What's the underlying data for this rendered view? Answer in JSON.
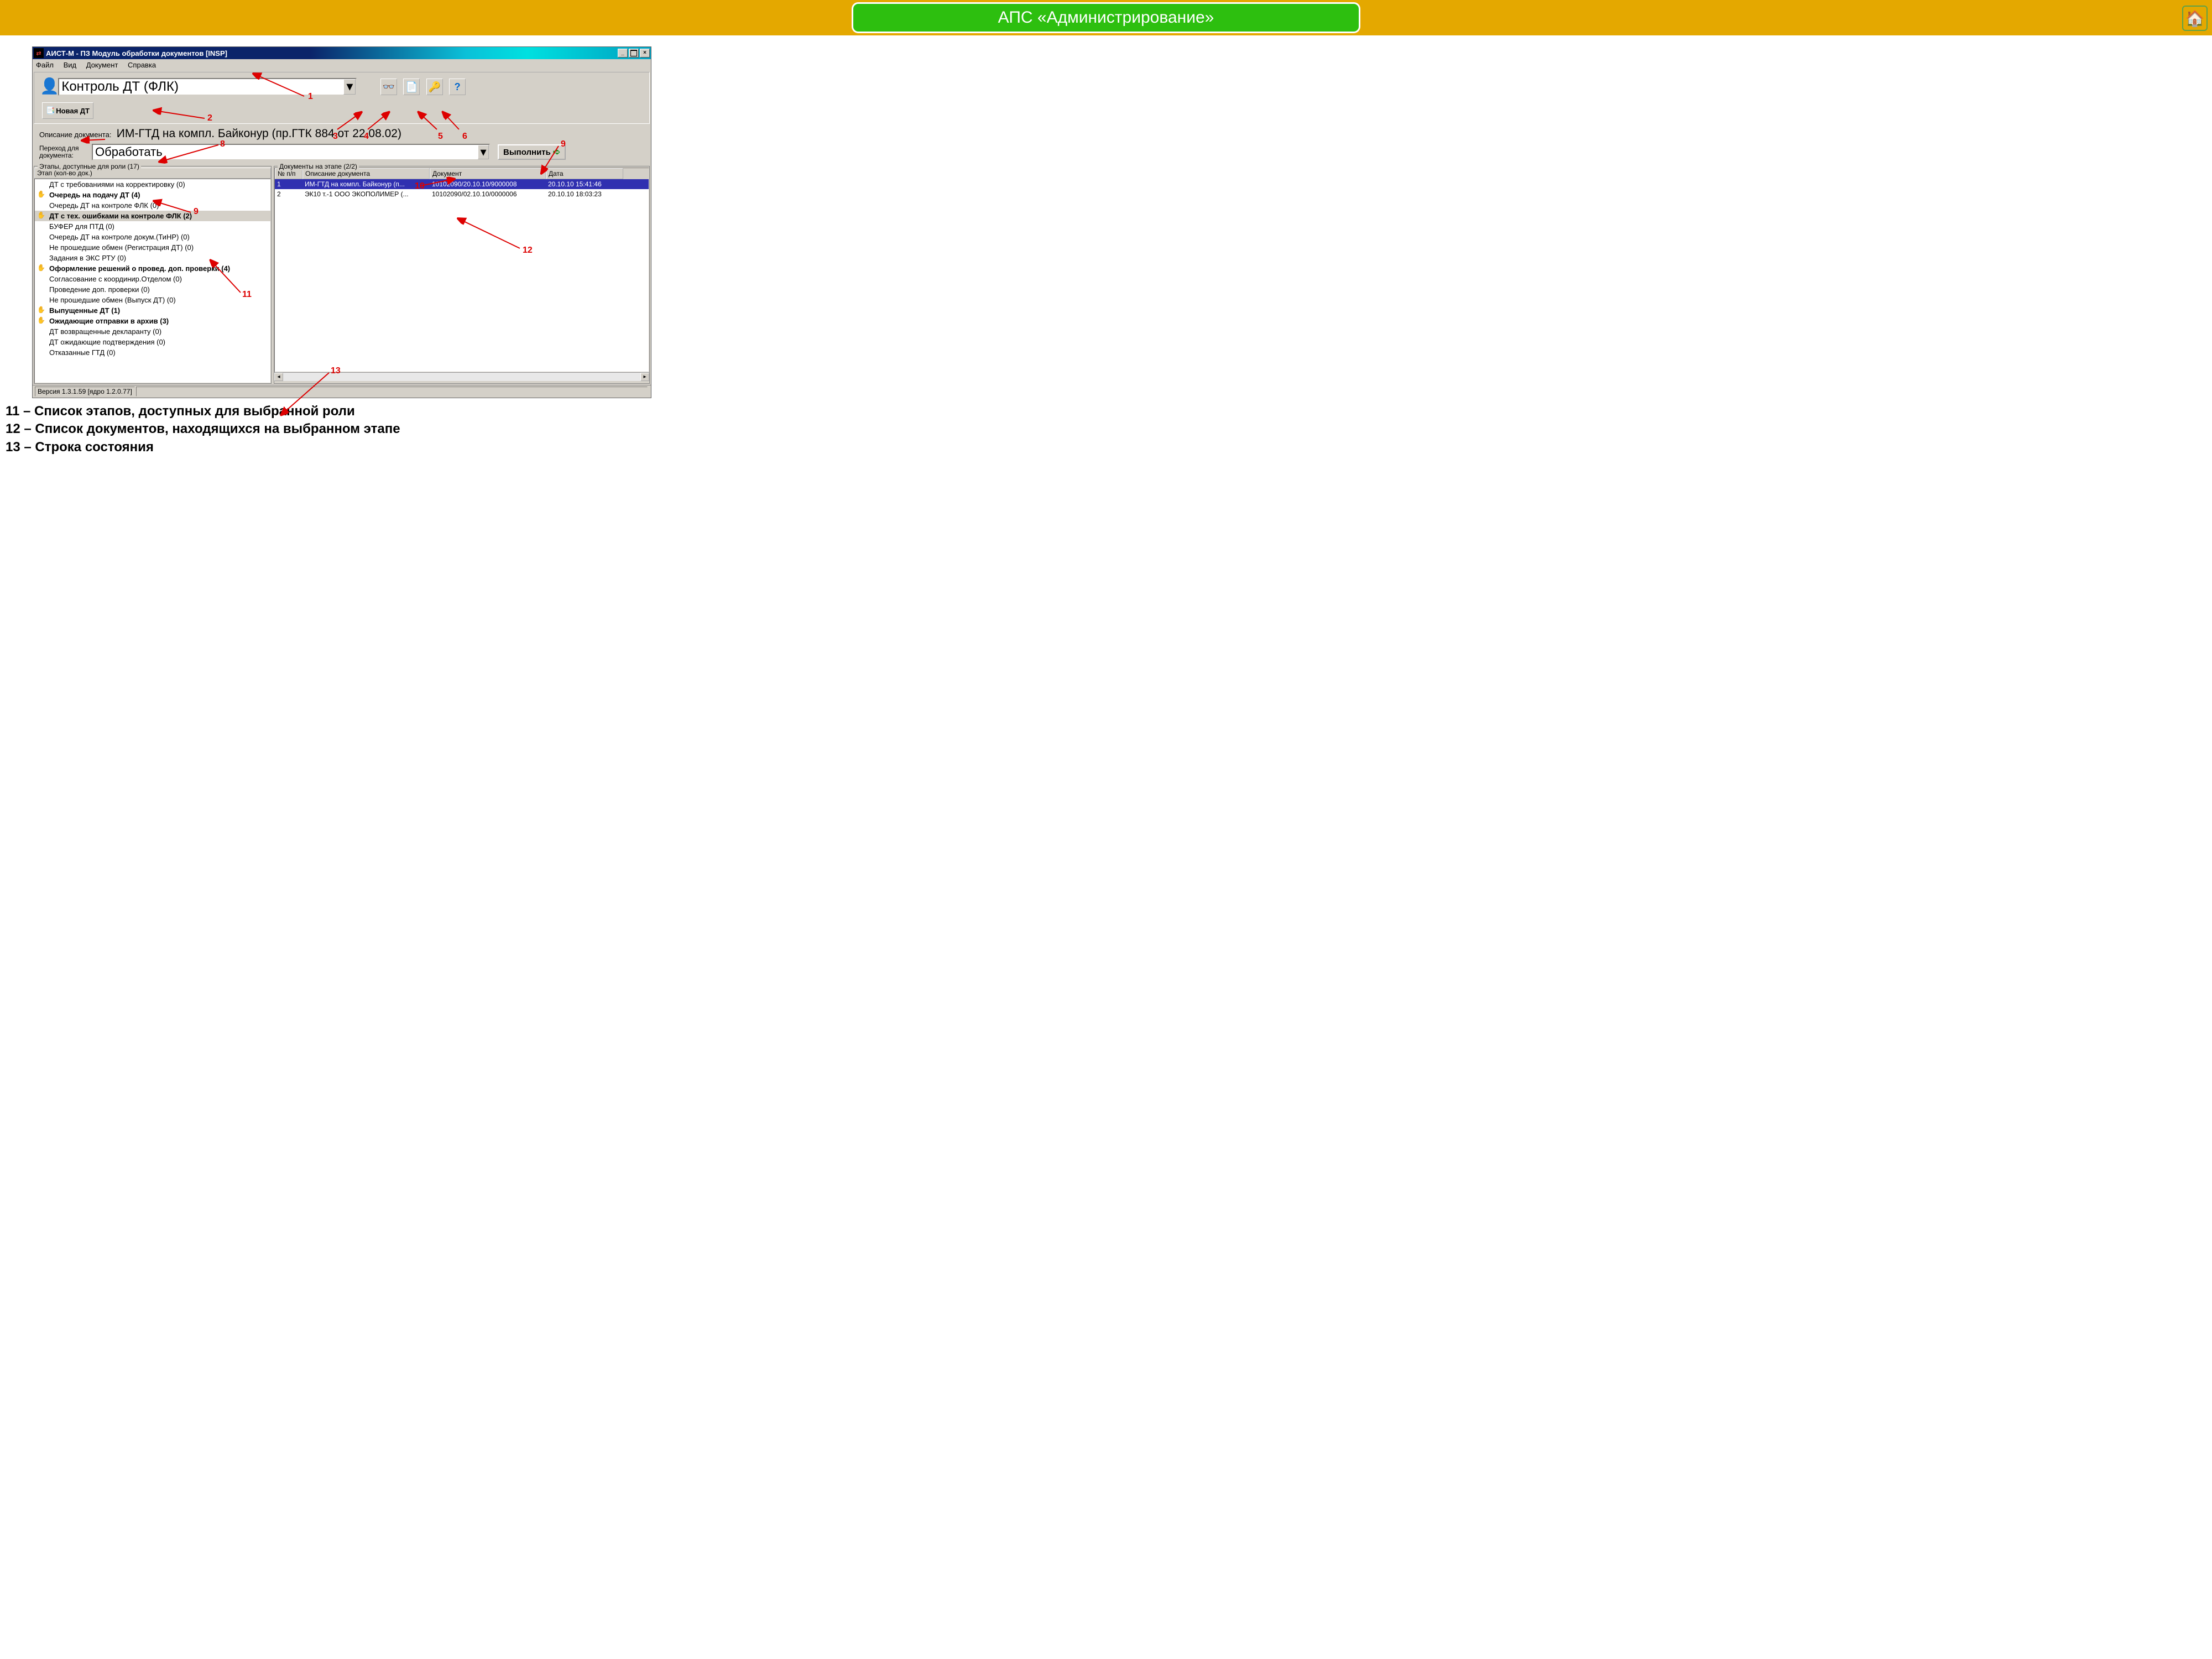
{
  "slide": {
    "title": "АПС «Администрирование»"
  },
  "window": {
    "title": "АИСТ-М - ПЗ Модуль обработки документов [INSP]"
  },
  "menu": {
    "file": "Файл",
    "view": "Вид",
    "document": "Документ",
    "help": "Справка"
  },
  "toolbar": {
    "role": "Контроль ДТ (ФЛК)",
    "new_dt": "Новая ДТ"
  },
  "doc": {
    "label": "Описание документа:",
    "text": "ИМ-ГТД на компл. Байконур (пр.ГТК 884 от 22.08.02)",
    "trans_label": "Переход для документа:",
    "action": "Обработать",
    "execute": "Выполнить"
  },
  "left_pane": {
    "title": "Этапы, доступные для роли (17)",
    "header": "Этап (кол-во док.)",
    "items": [
      {
        "t": "ДТ с требованиями на корректировку (0)",
        "bold": false,
        "icon": ""
      },
      {
        "t": "Очередь на подачу ДТ (4)",
        "bold": true,
        "icon": "h"
      },
      {
        "t": "Очередь ДТ на контроле ФЛК (0)",
        "bold": false,
        "icon": ""
      },
      {
        "t": "ДТ с тех. ошибками на контроле ФЛК (2)",
        "bold": true,
        "icon": "h",
        "sel": true
      },
      {
        "t": "БУФЕР для ПТД (0)",
        "bold": false,
        "icon": ""
      },
      {
        "t": "Очередь ДТ на контроле докум.(ТиНР) (0)",
        "bold": false,
        "icon": ""
      },
      {
        "t": "Не прошедшие обмен (Регистрация ДТ) (0)",
        "bold": false,
        "icon": ""
      },
      {
        "t": "Задания в ЭКС РТУ (0)",
        "bold": false,
        "icon": ""
      },
      {
        "t": "Оформление решений о провед. доп. проверки (4)",
        "bold": true,
        "icon": "h"
      },
      {
        "t": "Согласование с координир.Отделом (0)",
        "bold": false,
        "icon": ""
      },
      {
        "t": "Проведение доп. проверки (0)",
        "bold": false,
        "icon": ""
      },
      {
        "t": "Не прошедшие обмен (Выпуск ДТ) (0)",
        "bold": false,
        "icon": ""
      },
      {
        "t": "Выпущенные ДТ (1)",
        "bold": true,
        "icon": "h"
      },
      {
        "t": "Ожидающие отправки в архив (3)",
        "bold": true,
        "icon": "g"
      },
      {
        "t": "ДТ возвращенные декларанту (0)",
        "bold": false,
        "icon": ""
      },
      {
        "t": "ДТ ожидающие подтверждения (0)",
        "bold": false,
        "icon": ""
      },
      {
        "t": "Отказанные ГТД (0)",
        "bold": false,
        "icon": ""
      }
    ]
  },
  "right_pane": {
    "title": "Документы на этапе (2/2)",
    "cols": {
      "n": "№ п/п",
      "desc": "Описание документа",
      "doc": "Документ",
      "date": "Дата"
    },
    "rows": [
      {
        "n": "1",
        "desc": "ИМ-ГТД на компл. Байконур (п...",
        "doc": "10102090/20.10.10/9000008",
        "date": "20.10.10 15:41:46",
        "sel": true
      },
      {
        "n": "2",
        "desc": "ЭК10 т.-1 ООО ЭКОПОЛИМЕР (...",
        "doc": "10102090/02.10.10/0000006",
        "date": "20.10.10 18:03:23",
        "sel": false
      }
    ]
  },
  "status": {
    "version": "Версия 1.3.1.59 [ядро 1.2.0.77]"
  },
  "annotations": {
    "a1": "1",
    "a2": "2",
    "a3": "3",
    "a4": "4",
    "a5": "5",
    "a6": "6",
    "a8": "8",
    "a9": "9",
    "a9b": "9",
    "a10": "10",
    "a11": "11",
    "a12": "12",
    "a13": "13"
  },
  "captions": {
    "l1": "11 – Список этапов, доступных для выбранной роли",
    "l2": "12 – Список документов, находящихся на выбранном этапе",
    "l3": "13 – Строка состояния"
  }
}
